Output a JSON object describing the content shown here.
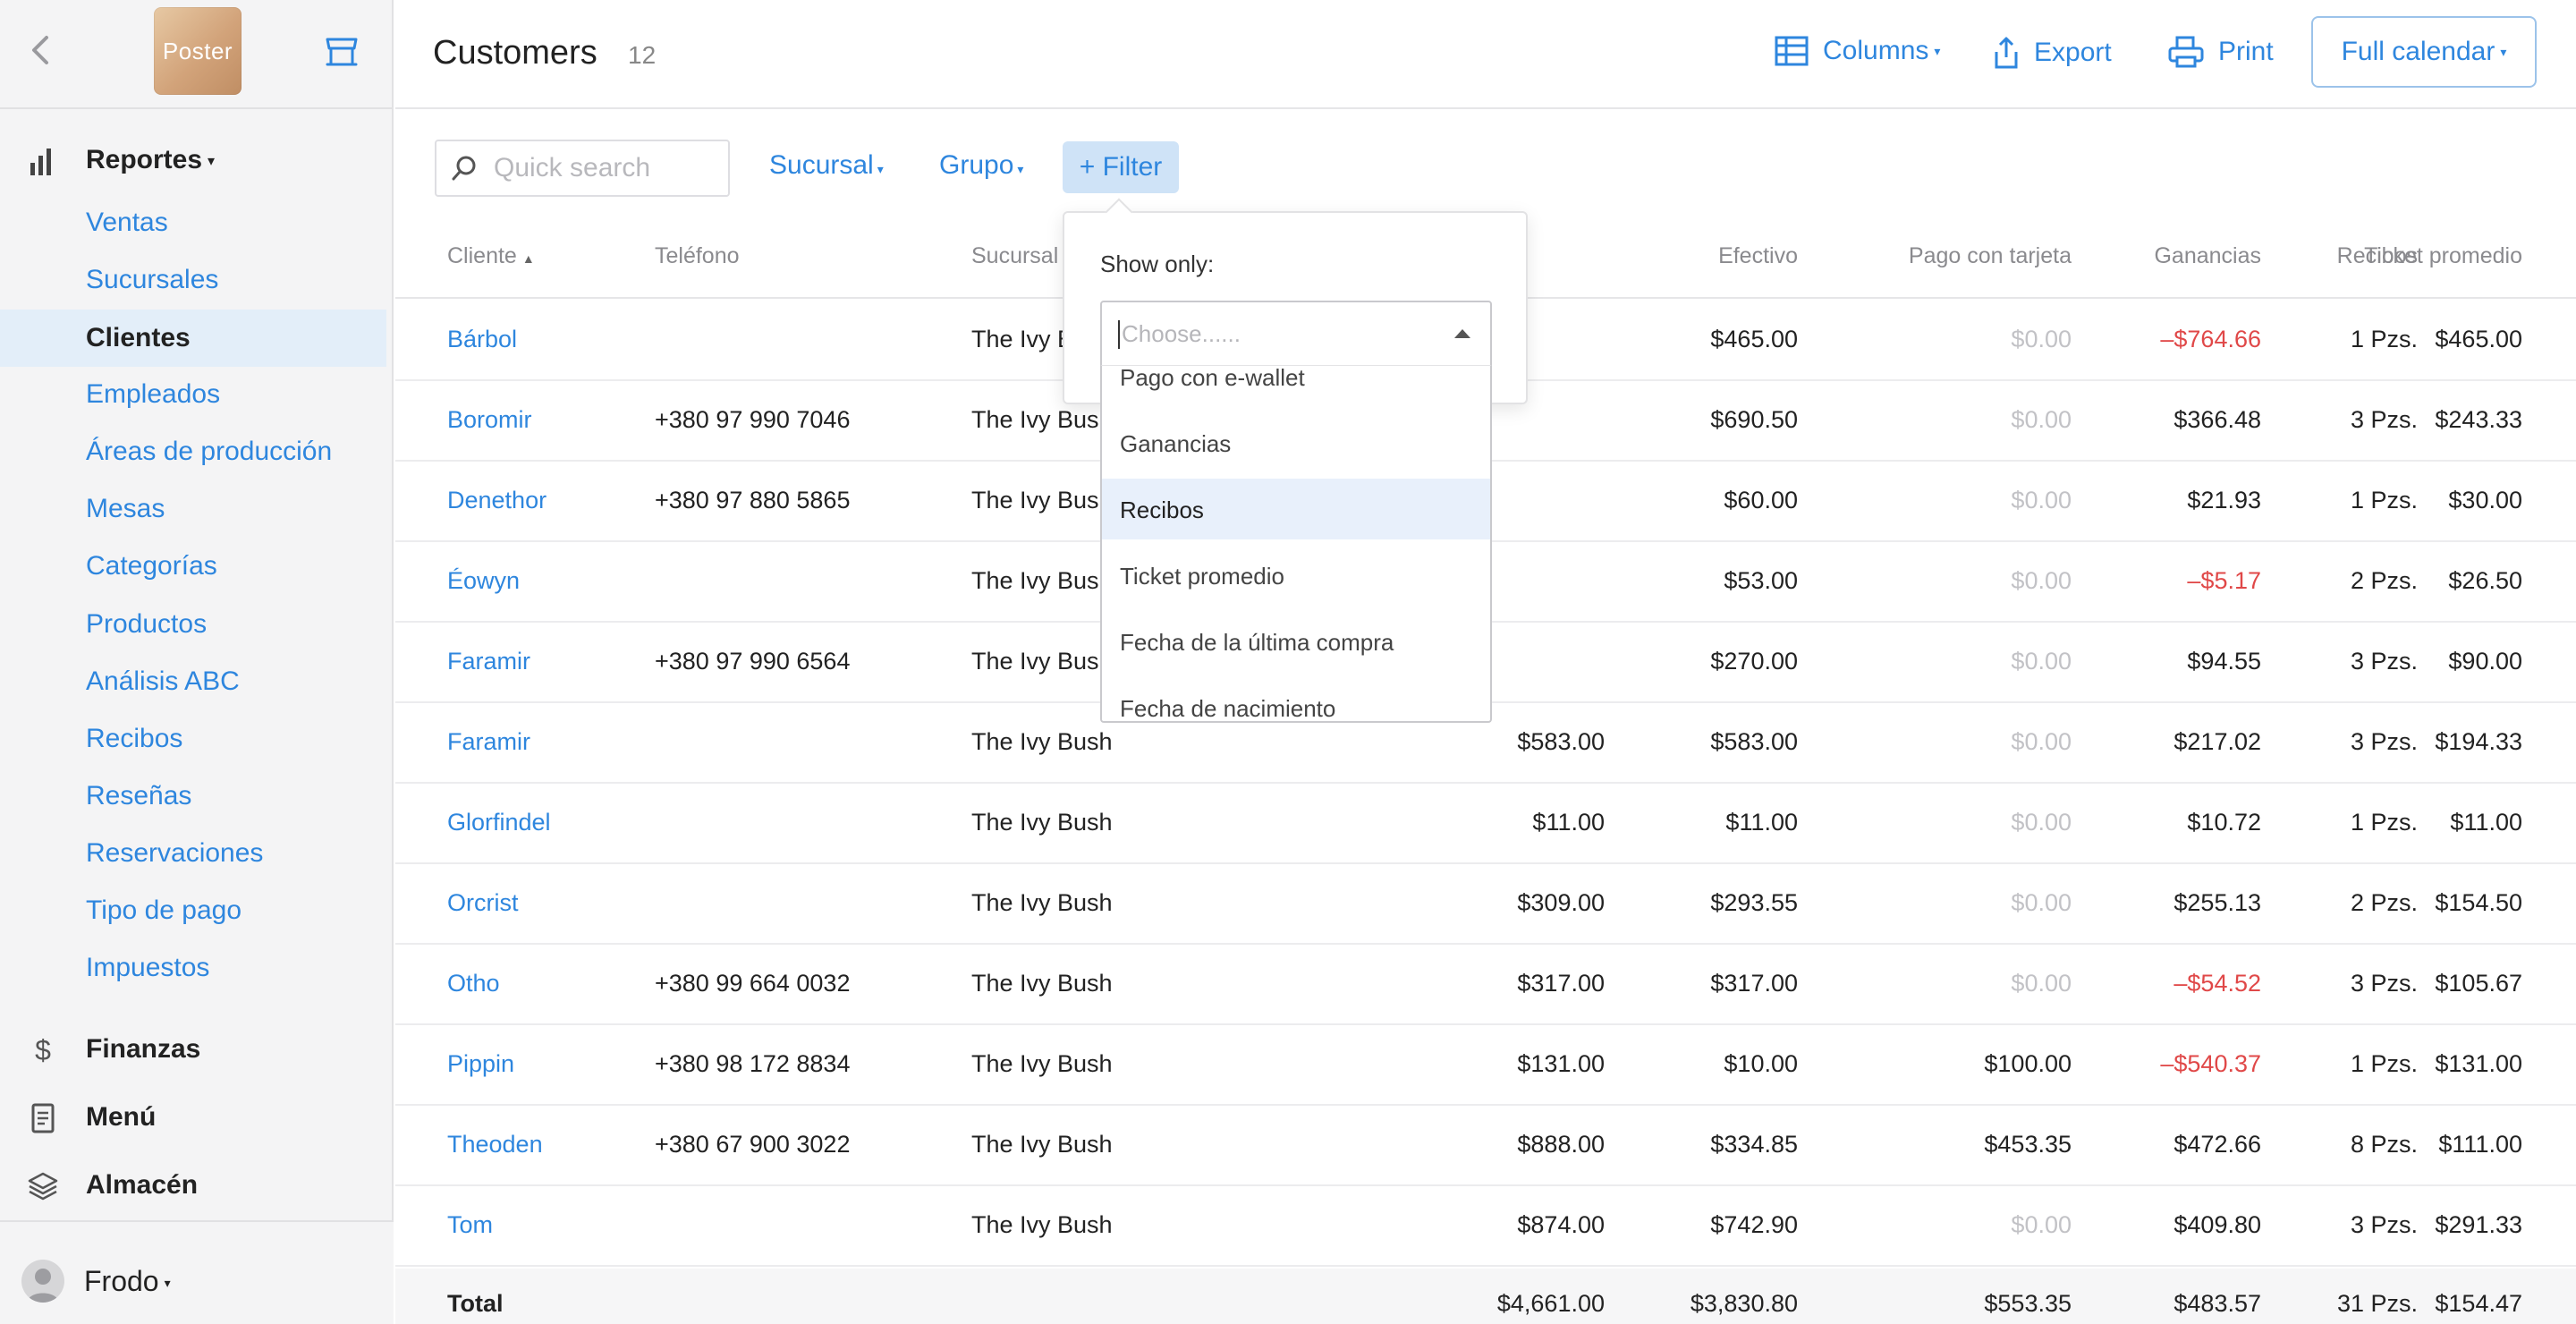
{
  "sidebar": {
    "logo_text": "Poster",
    "sections": {
      "reportes": "Reportes",
      "finanzas": "Finanzas",
      "menu": "Menú",
      "almacen": "Almacén"
    },
    "items": [
      {
        "label": "Ventas"
      },
      {
        "label": "Sucursales"
      },
      {
        "label": "Clientes",
        "active": true
      },
      {
        "label": "Empleados"
      },
      {
        "label": "Áreas de producción"
      },
      {
        "label": "Mesas"
      },
      {
        "label": "Categorías"
      },
      {
        "label": "Productos"
      },
      {
        "label": "Análisis ABC"
      },
      {
        "label": "Recibos"
      },
      {
        "label": "Reseñas"
      },
      {
        "label": "Reservaciones"
      },
      {
        "label": "Tipo de pago"
      },
      {
        "label": "Impuestos"
      }
    ],
    "user": "Frodo"
  },
  "header": {
    "title": "Customers",
    "count": "12",
    "columns_label": "Columns",
    "export_label": "Export",
    "print_label": "Print",
    "calendar_label": "Full calendar"
  },
  "filters": {
    "search_placeholder": "Quick search",
    "sucursal": "Sucursal",
    "grupo": "Grupo",
    "add_filter": "+ Filter"
  },
  "popover": {
    "label": "Show only:",
    "placeholder": "Choose......",
    "options": [
      "Pago con e-wallet",
      "Ganancias",
      "Recibos",
      "Ticket promedio",
      "Fecha de la última compra",
      "Fecha de nacimiento"
    ],
    "highlighted": "Recibos"
  },
  "table": {
    "columns": {
      "cliente": "Cliente",
      "telefono": "Teléfono",
      "sucursal": "Sucursal",
      "efectivo": "Efectivo",
      "tarjeta": "Pago con tarjeta",
      "ganancias": "Ganancias",
      "recibos": "Recibos",
      "ticket": "Ticket promedio"
    },
    "rows": [
      {
        "cliente": "Bárbol",
        "telefono": "",
        "sucursal": "The Ivy Bush",
        "total": "",
        "efectivo": "$465.00",
        "tarjeta": "$0.00",
        "ganancias": "–$764.66",
        "recibos": "1 Pzs.",
        "ticket": "$465.00"
      },
      {
        "cliente": "Boromir",
        "telefono": "+380 97 990 7046",
        "sucursal": "The Ivy Bush",
        "total": "",
        "efectivo": "$690.50",
        "tarjeta": "$0.00",
        "ganancias": "$366.48",
        "recibos": "3 Pzs.",
        "ticket": "$243.33"
      },
      {
        "cliente": "Denethor",
        "telefono": "+380 97 880 5865",
        "sucursal": "The Ivy Bush",
        "total": "",
        "efectivo": "$60.00",
        "tarjeta": "$0.00",
        "ganancias": "$21.93",
        "recibos": "1 Pzs.",
        "ticket": "$30.00"
      },
      {
        "cliente": "Éowyn",
        "telefono": "",
        "sucursal": "The Ivy Bush",
        "total": "",
        "efectivo": "$53.00",
        "tarjeta": "$0.00",
        "ganancias": "–$5.17",
        "recibos": "2 Pzs.",
        "ticket": "$26.50"
      },
      {
        "cliente": "Faramir",
        "telefono": "+380 97 990 6564",
        "sucursal": "The Ivy Bush",
        "total": "",
        "efectivo": "$270.00",
        "tarjeta": "$0.00",
        "ganancias": "$94.55",
        "recibos": "3 Pzs.",
        "ticket": "$90.00"
      },
      {
        "cliente": "Faramir",
        "telefono": "",
        "sucursal": "The Ivy Bush",
        "total": "$583.00",
        "efectivo": "$583.00",
        "tarjeta": "$0.00",
        "ganancias": "$217.02",
        "recibos": "3 Pzs.",
        "ticket": "$194.33"
      },
      {
        "cliente": "Glorfindel",
        "telefono": "",
        "sucursal": "The Ivy Bush",
        "total": "$11.00",
        "efectivo": "$11.00",
        "tarjeta": "$0.00",
        "ganancias": "$10.72",
        "recibos": "1 Pzs.",
        "ticket": "$11.00"
      },
      {
        "cliente": "Orcrist",
        "telefono": "",
        "sucursal": "The Ivy Bush",
        "total": "$309.00",
        "efectivo": "$293.55",
        "tarjeta": "$0.00",
        "ganancias": "$255.13",
        "recibos": "2 Pzs.",
        "ticket": "$154.50"
      },
      {
        "cliente": "Otho",
        "telefono": "+380 99 664 0032",
        "sucursal": "The Ivy Bush",
        "total": "$317.00",
        "efectivo": "$317.00",
        "tarjeta": "$0.00",
        "ganancias": "–$54.52",
        "recibos": "3 Pzs.",
        "ticket": "$105.67"
      },
      {
        "cliente": "Pippin",
        "telefono": "+380 98 172 8834",
        "sucursal": "The Ivy Bush",
        "total": "$131.00",
        "efectivo": "$10.00",
        "tarjeta": "$100.00",
        "ganancias": "–$540.37",
        "recibos": "1 Pzs.",
        "ticket": "$131.00"
      },
      {
        "cliente": "Theoden",
        "telefono": "+380 67 900 3022",
        "sucursal": "The Ivy Bush",
        "total": "$888.00",
        "efectivo": "$334.85",
        "tarjeta": "$453.35",
        "ganancias": "$472.66",
        "recibos": "8 Pzs.",
        "ticket": "$111.00"
      },
      {
        "cliente": "Tom",
        "telefono": "",
        "sucursal": "The Ivy Bush",
        "total": "$874.00",
        "efectivo": "$742.90",
        "tarjeta": "$0.00",
        "ganancias": "$409.80",
        "recibos": "3 Pzs.",
        "ticket": "$291.33"
      }
    ],
    "totals": {
      "label": "Total",
      "total": "$4,661.00",
      "efectivo": "$3,830.80",
      "tarjeta": "$553.35",
      "ganancias": "$483.57",
      "recibos": "31 Pzs.",
      "ticket": "$154.47"
    }
  },
  "colors": {
    "accent": "#2e86de",
    "negative": "#e04848",
    "active_bg": "#e3eef9"
  }
}
